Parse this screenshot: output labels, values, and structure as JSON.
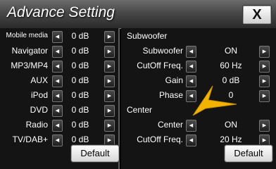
{
  "window": {
    "title": "Advance Setting",
    "close_label": "X"
  },
  "volume": {
    "rows": [
      {
        "label": "Mobile media",
        "value": "0 dB"
      },
      {
        "label": "Navigator",
        "value": "0 dB"
      },
      {
        "label": "MP3/MP4",
        "value": "0 dB"
      },
      {
        "label": "AUX",
        "value": "0 dB"
      },
      {
        "label": "iPod",
        "value": "0 dB"
      },
      {
        "label": "DVD",
        "value": "0 dB"
      },
      {
        "label": "Radio",
        "value": "0 dB"
      },
      {
        "label": "TV/DAB+",
        "value": "0 dB"
      }
    ],
    "default_label": "Default"
  },
  "subwoofer": {
    "header": "Subwoofer",
    "rows": [
      {
        "label": "Subwoofer",
        "value": "ON"
      },
      {
        "label": "CutOff Freq.",
        "value": "60 Hz"
      },
      {
        "label": "Gain",
        "value": "0 dB"
      },
      {
        "label": "Phase",
        "value": "0"
      }
    ]
  },
  "center": {
    "header": "Center",
    "rows": [
      {
        "label": "Center",
        "value": "ON"
      },
      {
        "label": "CutOff Freq.",
        "value": "20 Hz"
      }
    ],
    "default_label": "Default"
  },
  "icons": {
    "left": "left-arrow-icon",
    "right": "right-arrow-icon",
    "close": "close-icon"
  },
  "colors": {
    "background": "#141414",
    "pointer": "#f2b400",
    "title_bar": "#4a4a4a"
  }
}
